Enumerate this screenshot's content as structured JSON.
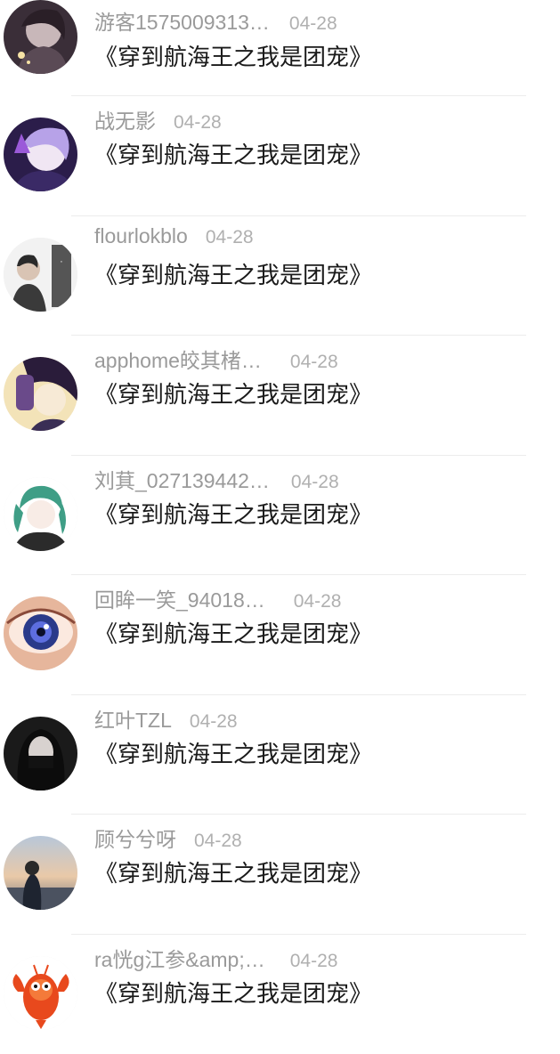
{
  "feed": {
    "items": [
      {
        "user": "游客1575009313…",
        "date": "04-28",
        "title": "《穿到航海王之我是团宠》"
      },
      {
        "user": "战无影",
        "date": "04-28",
        "title": "《穿到航海王之我是团宠》"
      },
      {
        "user": "flourlokblo",
        "date": "04-28",
        "title": "《穿到航海王之我是团宠》"
      },
      {
        "user": "apphome皎其楮…",
        "date": "04-28",
        "title": "《穿到航海王之我是团宠》"
      },
      {
        "user": "刘萁_027139442…",
        "date": "04-28",
        "title": "《穿到航海王之我是团宠》"
      },
      {
        "user": "回眸一笑_94018…",
        "date": "04-28",
        "title": "《穿到航海王之我是团宠》"
      },
      {
        "user": "红叶TZL",
        "date": "04-28",
        "title": "《穿到航海王之我是团宠》"
      },
      {
        "user": "顾兮兮呀",
        "date": "04-28",
        "title": "《穿到航海王之我是团宠》"
      },
      {
        "user": "ra恍g江参&amp;…",
        "date": "04-28",
        "title": "《穿到航海王之我是团宠》"
      }
    ]
  }
}
